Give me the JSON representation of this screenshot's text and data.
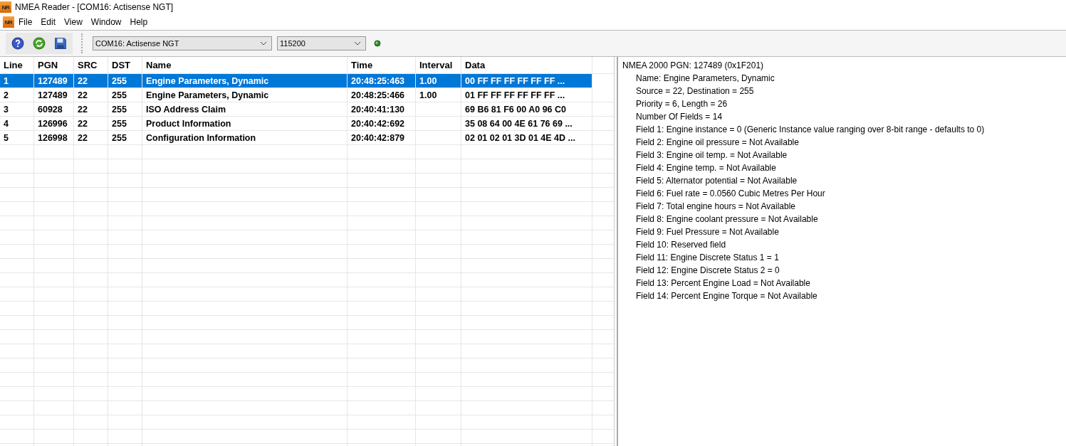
{
  "window": {
    "title": "NMEA Reader - [COM16: Actisense NGT]",
    "logo": "NR"
  },
  "menu_logo": "NR",
  "menu": [
    "File",
    "Edit",
    "View",
    "Window",
    "Help"
  ],
  "toolbar": {
    "port": "COM16: Actisense NGT",
    "baud": "115200"
  },
  "table": {
    "columns": [
      "Line",
      "PGN",
      "SRC",
      "DST",
      "Name",
      "Time",
      "Interval",
      "Data"
    ],
    "rows": [
      {
        "selected": true,
        "cells": [
          "1",
          "127489",
          "22",
          "255",
          "Engine Parameters, Dynamic",
          "20:48:25:463",
          "1.00",
          "00 FF FF FF FF FF FF ..."
        ]
      },
      {
        "selected": false,
        "cells": [
          "2",
          "127489",
          "22",
          "255",
          "Engine Parameters, Dynamic",
          "20:48:25:466",
          "1.00",
          "01 FF FF FF FF FF FF ..."
        ]
      },
      {
        "selected": false,
        "cells": [
          "3",
          "60928",
          "22",
          "255",
          "ISO Address Claim",
          "20:40:41:130",
          "",
          "69 B6 81 F6 00 A0 96 C0"
        ]
      },
      {
        "selected": false,
        "cells": [
          "4",
          "126996",
          "22",
          "255",
          "Product Information",
          "20:40:42:692",
          "",
          "35 08 64 00 4E 61 76 69 ..."
        ]
      },
      {
        "selected": false,
        "cells": [
          "5",
          "126998",
          "22",
          "255",
          "Configuration Information",
          "20:40:42:879",
          "",
          "02 01 02 01 3D 01 4E 4D ..."
        ]
      }
    ]
  },
  "detail": {
    "title": "NMEA 2000 PGN: 127489 (0x1F201)",
    "lines": [
      "Name: Engine Parameters, Dynamic",
      "Source = 22, Destination = 255",
      "Priority = 6, Length = 26",
      "Number Of Fields = 14",
      "Field 1: Engine instance = 0 (Generic Instance value ranging over 8-bit range - defaults to 0)",
      "Field 2: Engine oil pressure = Not Available",
      "Field 3: Engine oil temp. = Not Available",
      "Field 4: Engine temp. = Not Available",
      "Field 5: Alternator potential = Not Available",
      "Field 6: Fuel rate = 0.0560 Cubic Metres Per Hour",
      "Field 7: Total engine hours = Not Available",
      "Field 8: Engine coolant pressure = Not Available",
      "Field 9: Fuel Pressure = Not Available",
      "Field 10: Reserved field",
      "Field 11: Engine Discrete Status 1 = 1",
      "Field 12: Engine Discrete Status 2 = 0",
      "Field 13: Percent Engine Load = Not Available",
      "Field 14: Percent Engine Torque = Not Available"
    ]
  }
}
